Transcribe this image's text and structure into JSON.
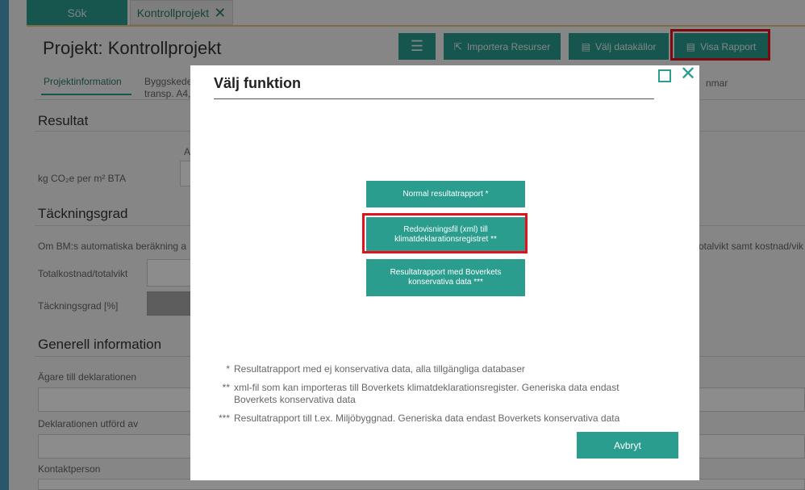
{
  "tabs": {
    "search": "Sök",
    "project": "Kontrollprojekt",
    "close": "✕"
  },
  "header": {
    "title": "Projekt: Kontrollprojekt",
    "menu_icon": "☰",
    "import_label": "Importera Resurser",
    "datasources_label": "Välj datakällor",
    "report_label": "Visa Rapport"
  },
  "subtabs": {
    "active": "Projektinformation",
    "second_line1": "Byggskede",
    "second_line2": "transp. A4,",
    "right": "nmar"
  },
  "background": {
    "result_heading": "Resultat",
    "result_col": "A",
    "co2_label": "kg CO₂e per m² BTA",
    "coverage_heading": "Täckningsgrad",
    "coverage_text_left": "Om BM:s automatiska beräkning a",
    "coverage_text_right": "otalvikt samt kostnad/vik",
    "total_cost_label": "Totalkostnad/totalvikt",
    "coverage_pct_label": "Täckningsgrad [%]",
    "general_heading": "Generell information",
    "owner_label": "Ägare till deklarationen",
    "performed_label": "Deklarationen utförd av",
    "contact_label": "Kontaktperson"
  },
  "modal": {
    "title": "Välj funktion",
    "max_icon": "maximize-icon",
    "close_icon": "✕",
    "btn_normal": "Normal resultatrapport *",
    "btn_xml_line1": "Redovisningsfil (xml) till",
    "btn_xml_line2": "klimatdeklarationsregistret **",
    "btn_conservative_line1": "Resultatrapport med Boverkets",
    "btn_conservative_line2": "konservativa data ***",
    "notes": [
      {
        "mark": "*",
        "text": "Resultatrapport med ej konservativa data, alla tillgängliga databaser"
      },
      {
        "mark": "**",
        "text": "xml-fil som kan importeras till Boverkets klimatdeklarationsregister. Generiska data endast",
        "text2": "Boverkets konservativa data"
      },
      {
        "mark": "***",
        "text": "Resultatrapport till t.ex. Miljöbyggnad. Generiska data endast Boverkets konservativa data"
      }
    ],
    "cancel_label": "Avbryt"
  },
  "colors": {
    "accent": "#2a9d8f",
    "highlight": "#e0121b"
  }
}
